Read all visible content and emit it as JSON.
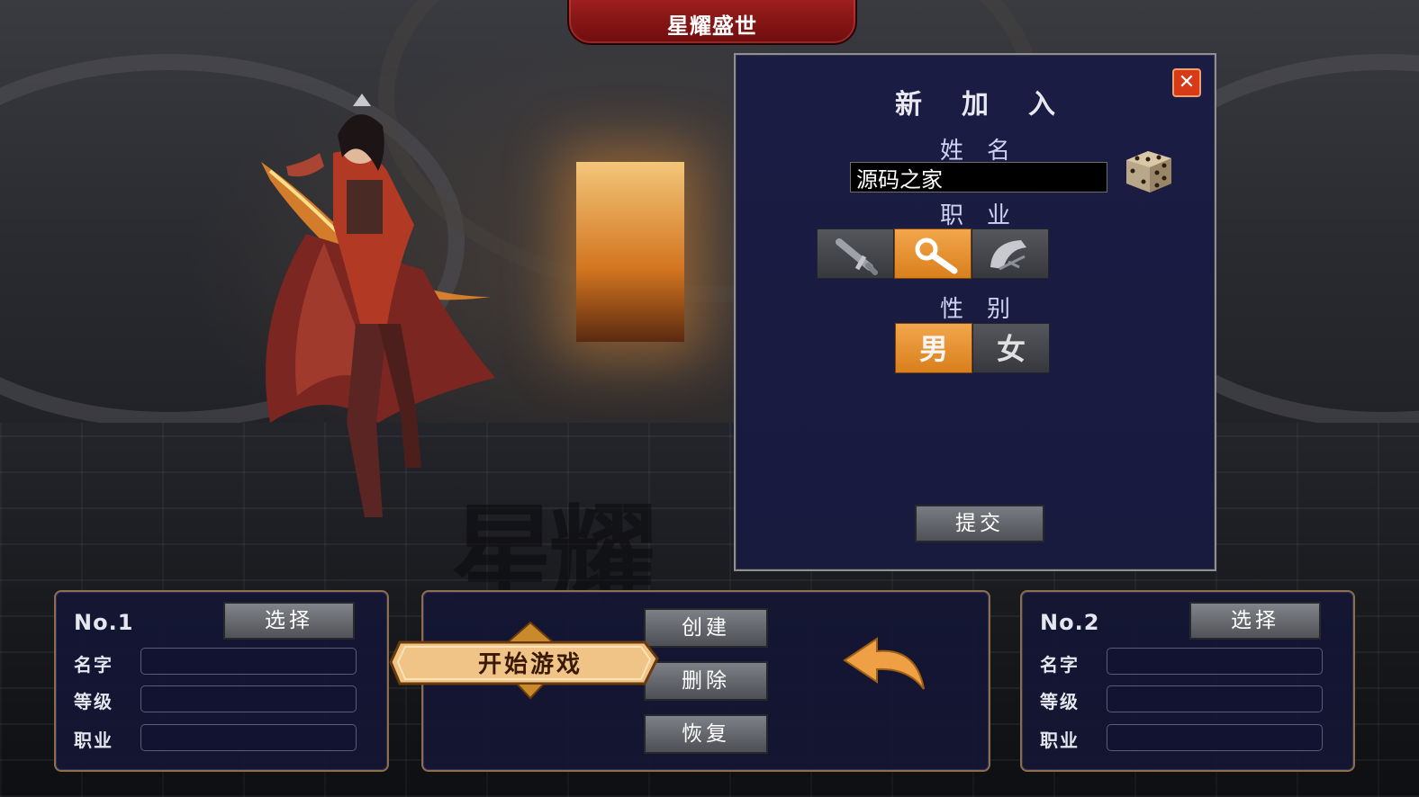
{
  "header": {
    "title": "星耀盛世"
  },
  "background": {
    "watermark": "星耀"
  },
  "dialog": {
    "title": "新加入",
    "name_label": "姓名",
    "name_value": "源码之家",
    "class_label": "职业",
    "classes": [
      {
        "icon": "sword-icon",
        "selected": false
      },
      {
        "icon": "staff-icon",
        "selected": true
      },
      {
        "icon": "fan-icon",
        "selected": false
      }
    ],
    "gender_label": "性别",
    "genders": [
      {
        "label": "男",
        "selected": true
      },
      {
        "label": "女",
        "selected": false
      }
    ],
    "submit_label": "提交",
    "close_icon": "close-icon",
    "random_icon": "dice-icon"
  },
  "slots": [
    {
      "number": "No.1",
      "select_label": "选择",
      "name_label": "名字",
      "level_label": "等级",
      "class_label": "职业",
      "name": "",
      "level": "",
      "class": ""
    },
    {
      "number": "No.2",
      "select_label": "选择",
      "name_label": "名字",
      "level_label": "等级",
      "class_label": "职业",
      "name": "",
      "level": "",
      "class": ""
    }
  ],
  "actions": {
    "start_label": "开始游戏",
    "create_label": "创建",
    "delete_label": "删除",
    "restore_label": "恢复",
    "back_icon": "back-arrow-icon"
  },
  "colors": {
    "accent_orange": "#f0a044",
    "title_red": "#8f1617",
    "panel_navy": "#1a1c44",
    "close_red": "#d63a17"
  }
}
